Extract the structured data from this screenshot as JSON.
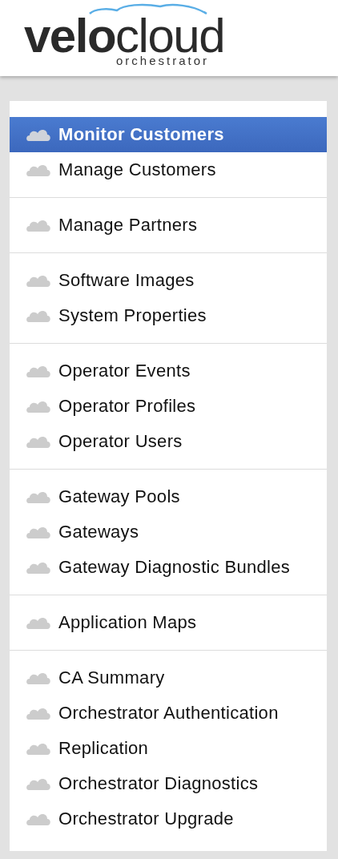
{
  "logo": {
    "name": "**velo**cloud",
    "subtitle": "orchestrator"
  },
  "menu": {
    "groups": [
      {
        "items": [
          {
            "label": "Monitor Customers",
            "selected": true
          },
          {
            "label": "Manage Customers",
            "selected": false
          }
        ]
      },
      {
        "items": [
          {
            "label": "Manage Partners",
            "selected": false
          }
        ]
      },
      {
        "items": [
          {
            "label": "Software Images",
            "selected": false
          },
          {
            "label": "System Properties",
            "selected": false
          }
        ]
      },
      {
        "items": [
          {
            "label": "Operator Events",
            "selected": false
          },
          {
            "label": "Operator Profiles",
            "selected": false
          },
          {
            "label": "Operator Users",
            "selected": false
          }
        ]
      },
      {
        "items": [
          {
            "label": "Gateway Pools",
            "selected": false
          },
          {
            "label": "Gateways",
            "selected": false
          },
          {
            "label": "Gateway Diagnostic Bundles",
            "selected": false
          }
        ]
      },
      {
        "items": [
          {
            "label": "Application Maps",
            "selected": false
          }
        ]
      },
      {
        "items": [
          {
            "label": "CA Summary",
            "selected": false
          },
          {
            "label": "Orchestrator Authentication",
            "selected": false
          },
          {
            "label": "Replication",
            "selected": false
          },
          {
            "label": "Orchestrator Diagnostics",
            "selected": false
          },
          {
            "label": "Orchestrator Upgrade",
            "selected": false
          }
        ]
      }
    ]
  }
}
